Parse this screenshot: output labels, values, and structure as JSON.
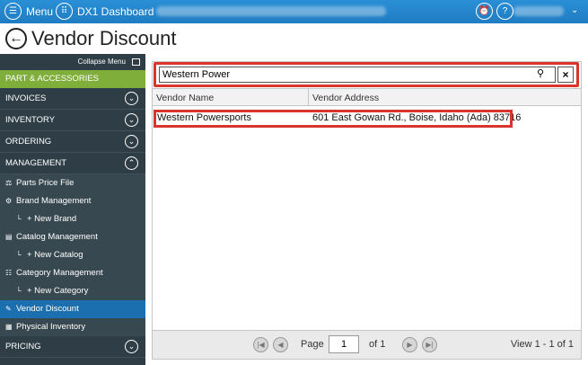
{
  "topbar": {
    "menu_label": "Menu",
    "dashboard_label": "DX1 Dashboard"
  },
  "page": {
    "title": "Vendor Discount"
  },
  "sidebar": {
    "collapse_label": "Collapse Menu",
    "section_label": "PART & ACCESSORIES",
    "sections": [
      {
        "label": "INVOICES",
        "toggle": "⌄"
      },
      {
        "label": "INVENTORY",
        "toggle": "⌄"
      },
      {
        "label": "ORDERING",
        "toggle": "⌄"
      },
      {
        "label": "MANAGEMENT",
        "toggle": "⌃"
      }
    ],
    "management_items": [
      {
        "label": "Parts Price File",
        "icon": "⚖"
      },
      {
        "label": "Brand Management",
        "icon": "⚙"
      },
      {
        "label": "+ New Brand",
        "icon": "└"
      },
      {
        "label": "Catalog Management",
        "icon": "▤"
      },
      {
        "label": "+ New Catalog",
        "icon": "└"
      },
      {
        "label": "Category Management",
        "icon": "☷"
      },
      {
        "label": "+ New Category",
        "icon": "└"
      },
      {
        "label": "Vendor Discount",
        "icon": "✎"
      },
      {
        "label": "Physical Inventory",
        "icon": "▦"
      }
    ],
    "pricing_label": "PRICING"
  },
  "search": {
    "value": "Western Power",
    "placeholder": ""
  },
  "table": {
    "headers": [
      "Vendor Name",
      "Vendor Address"
    ],
    "rows": [
      [
        "Western Powersports",
        "601 East Gowan Rd., Boise, Idaho (Ada) 83716"
      ]
    ]
  },
  "pager": {
    "page_label": "Page",
    "page_value": "1",
    "of_label": "of 1",
    "view_label": "View 1 - 1 of 1"
  },
  "colors": {
    "topbar": "#1f7cc2",
    "sidebar": "#2f3e46",
    "section_green": "#7fae3b",
    "active_item": "#1c6fae",
    "highlight": "#d9352c"
  }
}
